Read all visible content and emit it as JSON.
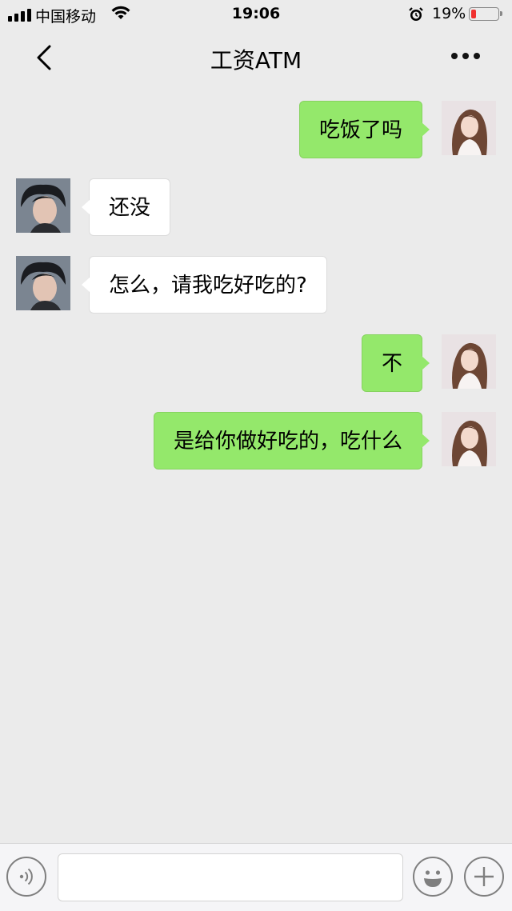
{
  "status_bar": {
    "carrier": "中国移动",
    "time": "19:06",
    "battery_percent": "19%",
    "battery_level": 0.19,
    "signal_icon": "signal-bars-icon",
    "wifi_icon": "wifi-icon",
    "alarm_icon": "alarm-clock-icon",
    "battery_color": "#f0302f"
  },
  "nav": {
    "title": "工资ATM",
    "back_icon": "chevron-left-icon",
    "more_icon": "more-dots-icon"
  },
  "messages": [
    {
      "sender": "me",
      "text": "吃饭了吗"
    },
    {
      "sender": "other",
      "text": "还没"
    },
    {
      "sender": "other",
      "text": "怎么，请我吃好吃的?"
    },
    {
      "sender": "me",
      "text": "不"
    },
    {
      "sender": "me",
      "text": "是给你做好吃的，吃什么"
    }
  ],
  "colors": {
    "my_bubble": "#94e86b",
    "other_bubble": "#ffffff",
    "background": "#ebebeb"
  },
  "input_bar": {
    "value": "",
    "voice_icon": "voice-icon",
    "emoji_icon": "emoji-smile-icon",
    "plus_icon": "plus-icon"
  }
}
